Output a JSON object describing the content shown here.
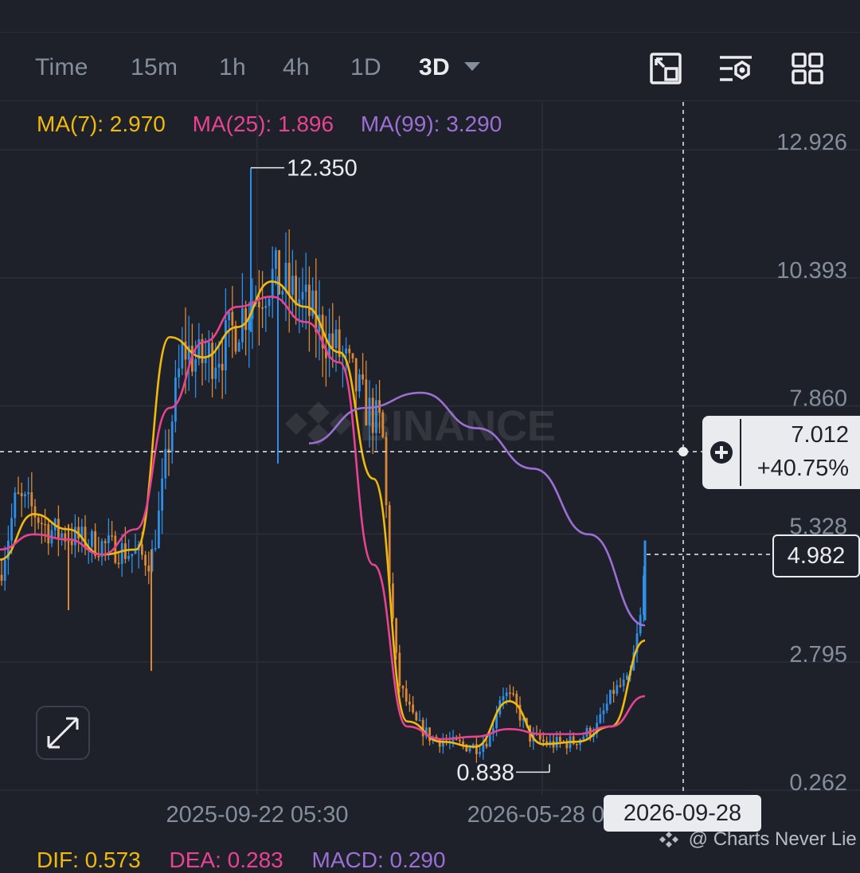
{
  "toolbar": {
    "intervals": [
      "Time",
      "15m",
      "1h",
      "4h",
      "1D",
      "3D"
    ],
    "active_interval": "3D"
  },
  "indicators": {
    "ma7": "MA(7): 2.970",
    "ma25": "MA(25): 1.896",
    "ma99": "MA(99): 3.290",
    "dif": "DIF: 0.573",
    "dea": "DEA: 0.283",
    "macd": "MACD: 0.290"
  },
  "crosshair": {
    "price": "7.012",
    "change": "+40.75%",
    "date": "2026-09-28"
  },
  "last_price": "4.982",
  "watermark": "@ Charts Never Lie",
  "colors": {
    "up": "#2f8fe8",
    "down": "#d98836",
    "ma7": "#f0b90b",
    "ma25": "#e84393",
    "ma99": "#9b6fd4",
    "background": "#1e2129",
    "grid": "#2b2f39",
    "axis_text": "#848e9c"
  },
  "chart_data": {
    "type": "candlestick",
    "title": "",
    "y_ticks": [
      12.926,
      10.393,
      7.86,
      5.328,
      2.795,
      0.262
    ],
    "ylim": [
      0.262,
      12.926
    ],
    "x_tick_labels": [
      "2025-09-22 05:30",
      "2026-05-28 05"
    ],
    "high_marker": "12.350",
    "low_marker": "0.838",
    "grid": true,
    "phases": [
      {
        "segment": "start",
        "price_range": [
          4.3,
          6.6
        ]
      },
      {
        "segment": "rally",
        "price_range": [
          7.0,
          10.2
        ]
      },
      {
        "segment": "peak",
        "price_range": [
          8.5,
          12.35
        ]
      },
      {
        "segment": "decline",
        "price_range": [
          0.9,
          8.0
        ]
      },
      {
        "segment": "bottom",
        "price_range": [
          0.838,
          2.9
        ]
      },
      {
        "segment": "breakout",
        "price_range": [
          1.4,
          4.982
        ]
      }
    ],
    "series": [
      {
        "name": "MA(7)",
        "values": [
          4.6,
          5.5,
          5.2,
          4.7,
          4.8,
          9.0,
          8.6,
          9.2,
          10.1,
          9.6,
          8.7,
          6.2,
          1.4,
          1.0,
          0.9,
          1.8,
          0.95,
          1.0,
          1.3,
          3.0
        ]
      },
      {
        "name": "MA(25)",
        "values": [
          4.8,
          5.1,
          5.0,
          4.7,
          5.2,
          7.6,
          8.9,
          9.6,
          9.8,
          9.3,
          8.5,
          4.5,
          1.3,
          1.05,
          1.1,
          1.25,
          1.15,
          1.15,
          1.3,
          1.9
        ]
      },
      {
        "name": "MA(99)",
        "values": [
          6.9,
          7.6,
          7.9,
          7.2,
          6.4,
          5.1,
          3.3
        ]
      }
    ]
  }
}
